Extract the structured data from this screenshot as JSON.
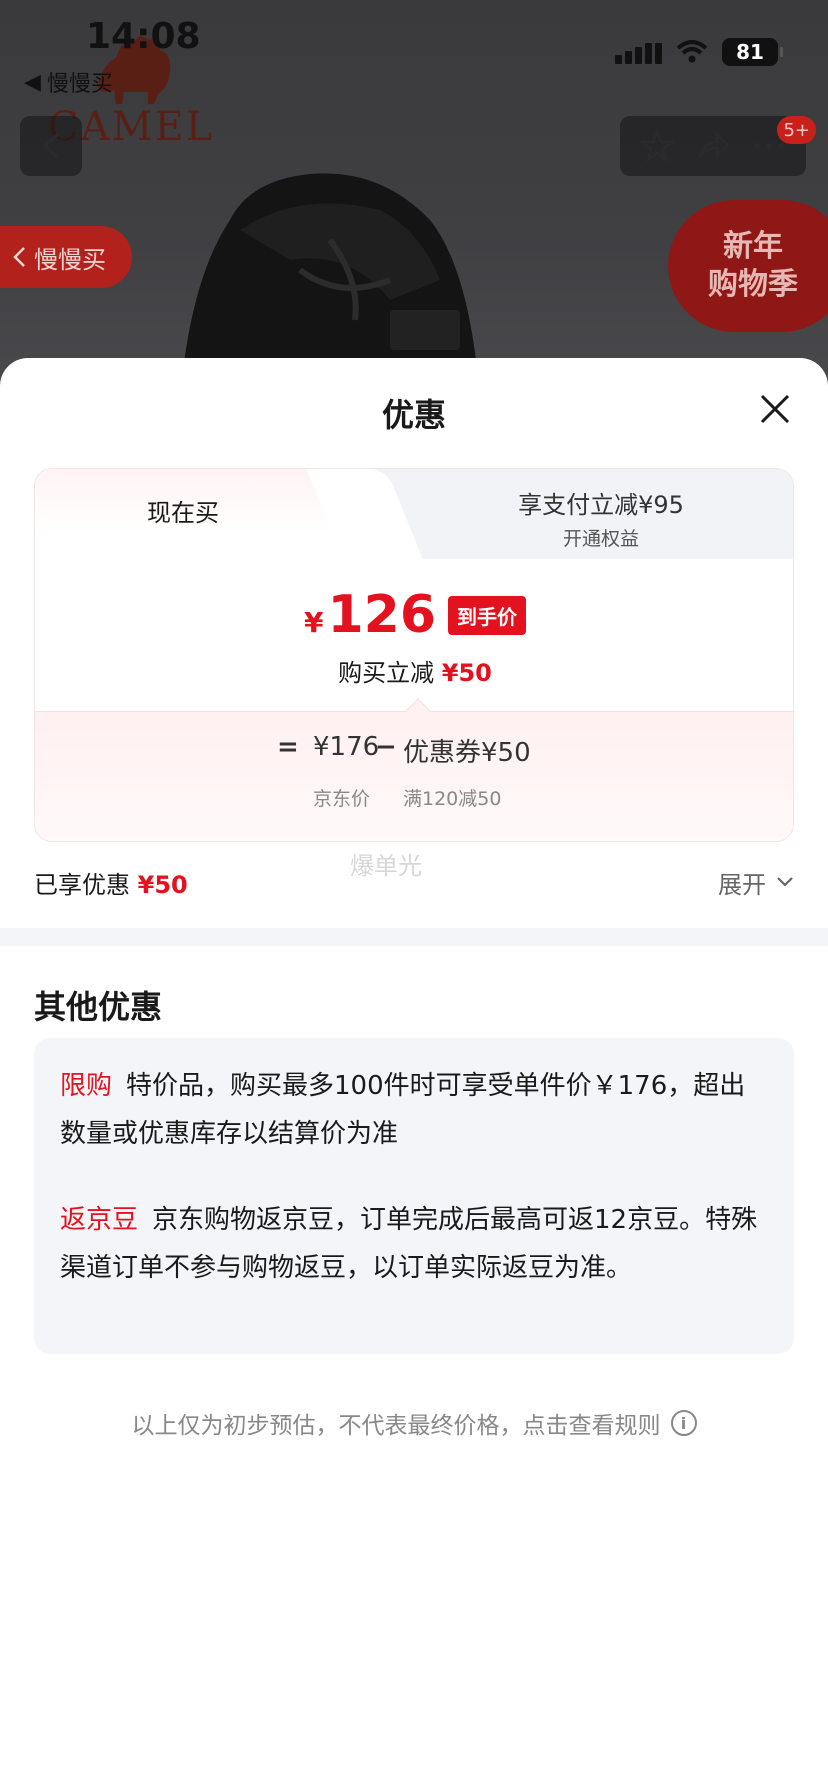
{
  "status_bar": {
    "time": "14:08",
    "back_app": "慢慢买",
    "battery": "81"
  },
  "backdrop": {
    "brand": "CAMEL",
    "slowbuy_pill": "慢慢买",
    "promo_line1": "新年",
    "promo_line2": "购物季",
    "badge_count": "5+"
  },
  "sheet": {
    "title": "优惠",
    "tabs": {
      "now": "现在买",
      "pay_main": "享支付立减¥95",
      "pay_sub": "开通权益"
    },
    "price": {
      "currency": "¥",
      "amount": "126",
      "tag": "到手价",
      "discount_label": "购买立减",
      "discount_value": "¥50"
    },
    "formula": {
      "equals": "=",
      "base_price": "¥176",
      "base_label": "京东价",
      "minus": "−",
      "coupon": "优惠券¥50",
      "coupon_rule": "满120减50"
    },
    "watermark": "爆单光",
    "enjoyed_label": "已享优惠",
    "enjoyed_value": "¥50",
    "expand_label": "展开",
    "other_title": "其他优惠",
    "offers": [
      {
        "tag": "限购",
        "text": "特价品，购买最多100件时可享受单件价￥176，超出数量或优惠库存以结算价为准"
      },
      {
        "tag": "返京豆",
        "text": "京东购物返京豆，订单完成后最高可返12京豆。特殊渠道订单不参与购物返豆，以订单实际返豆为准。"
      }
    ],
    "footnote": "以上仅为初步预估，不代表最终价格，点击查看规则"
  },
  "colors": {
    "accent_red": "#e3121e",
    "panel_gray": "#f4f5f8"
  }
}
